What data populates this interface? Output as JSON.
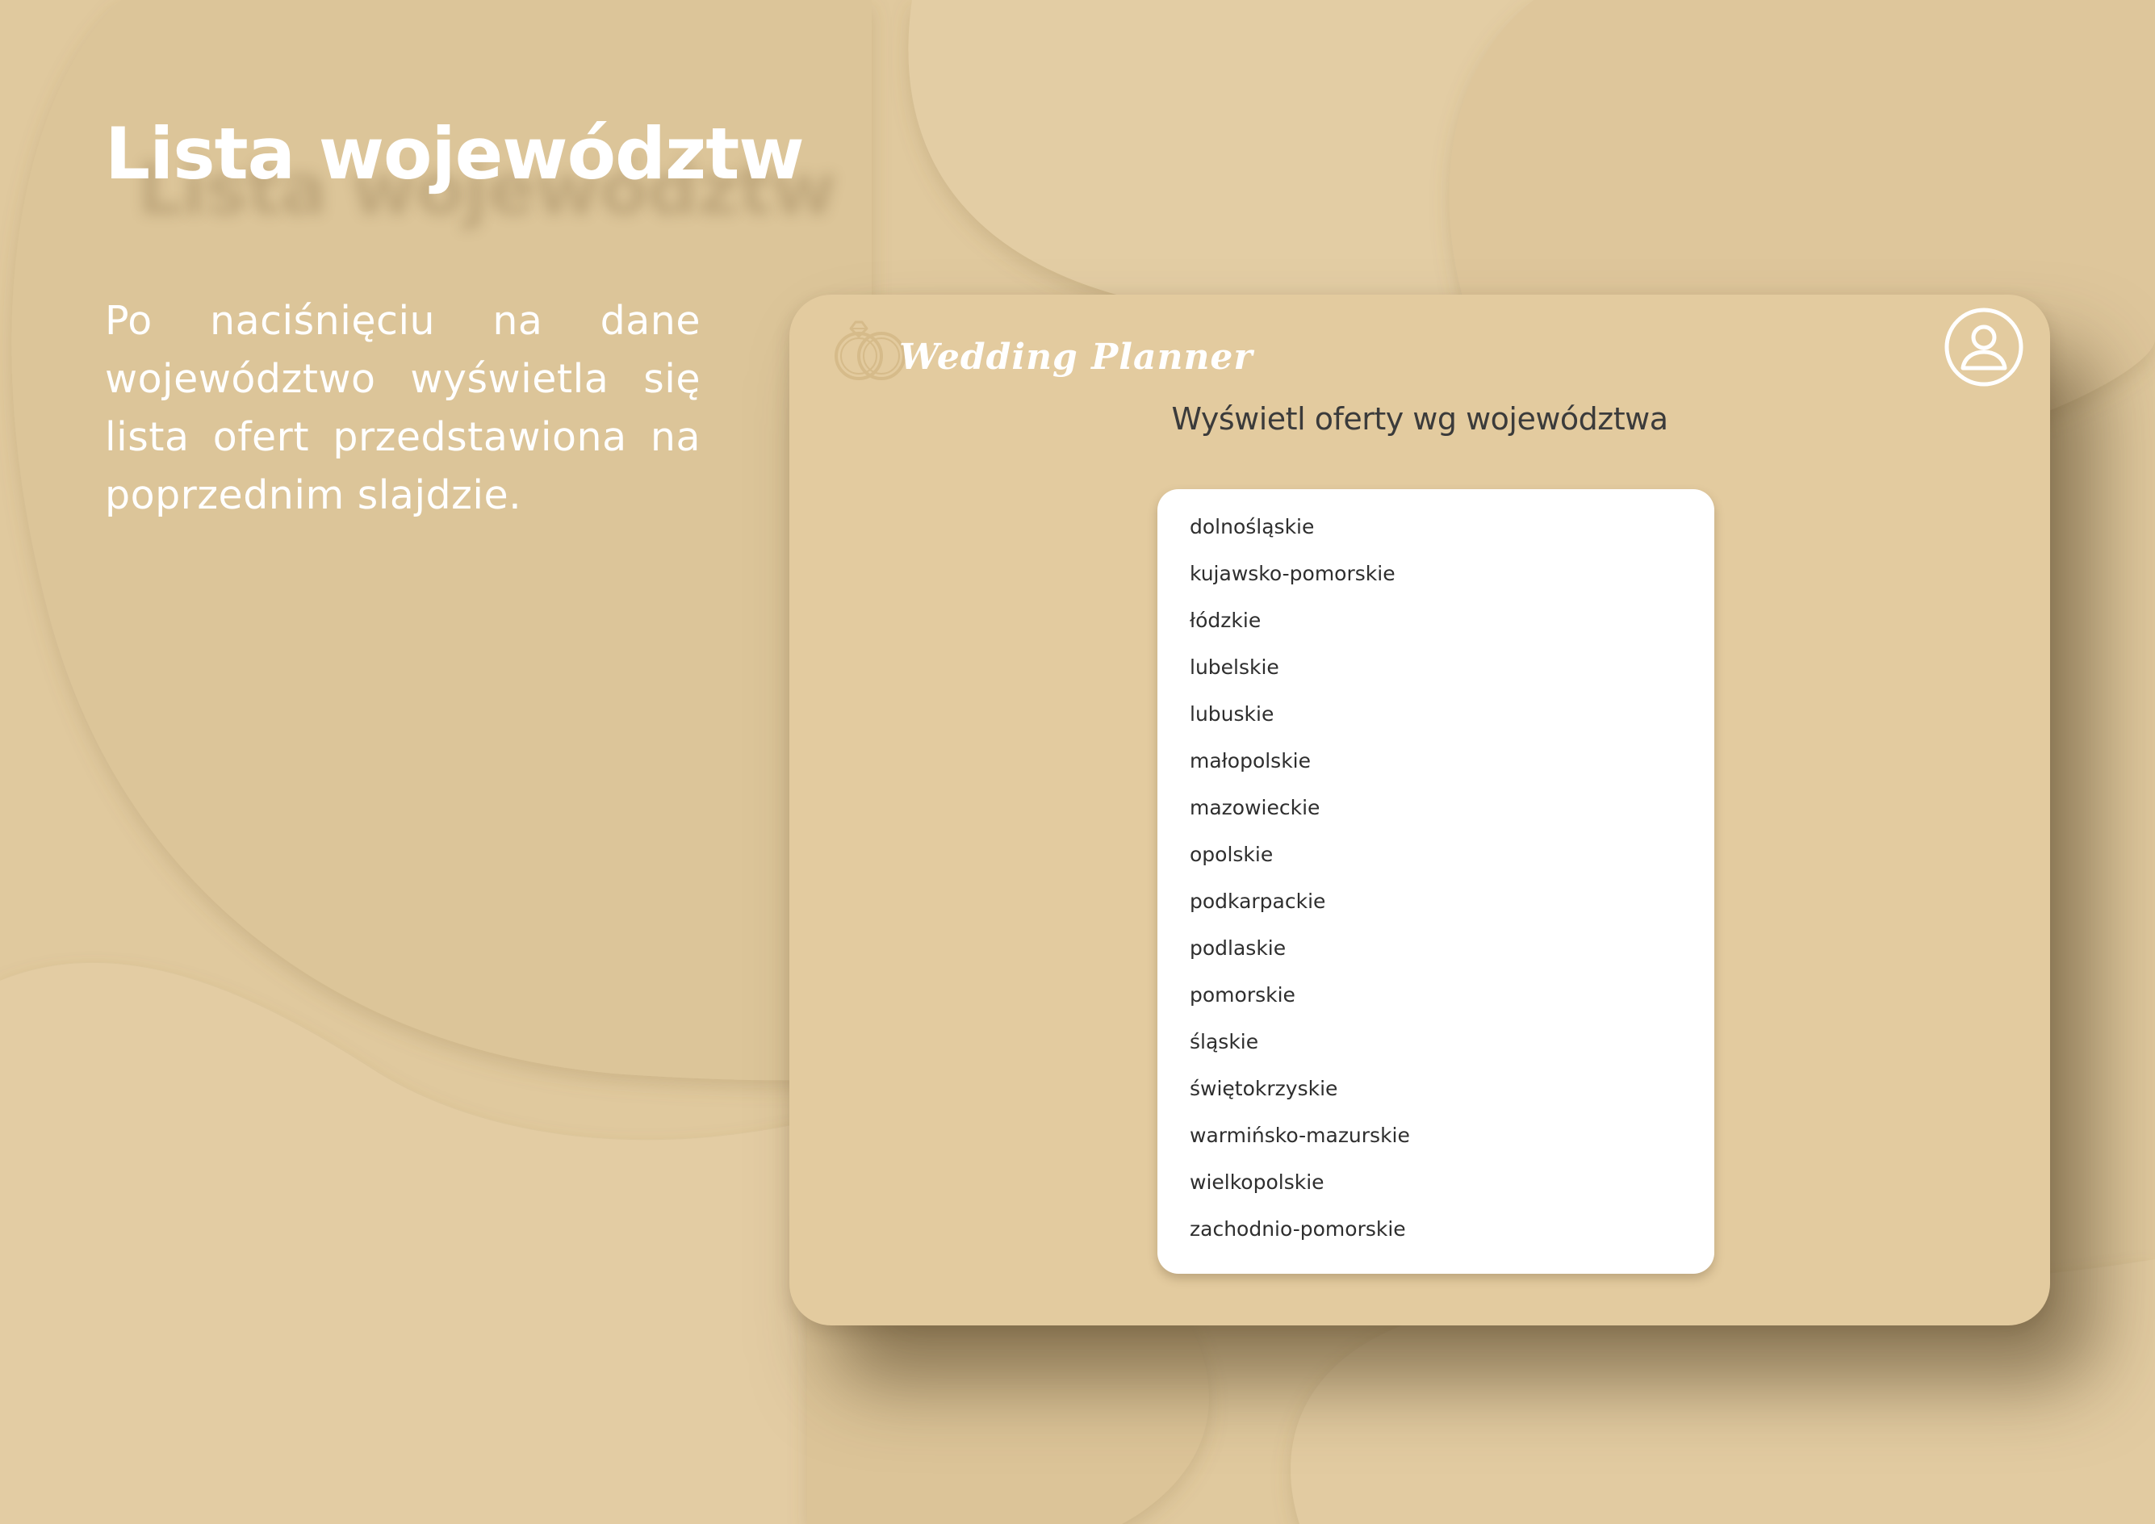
{
  "slide": {
    "title": "Lista województw",
    "description": "Po naciśnięciu na dane województwo wyświetla się lista ofert przedstawiona na poprzednim slajdzie."
  },
  "app": {
    "logo_text": "Wedding Planner",
    "header_title": "Wyświetl oferty wg województwa",
    "regions": [
      "dolnośląskie",
      "kujawsko-pomorskie",
      "łódzkie",
      "lubelskie",
      "lubuskie",
      "małopolskie",
      "mazowieckie",
      "opolskie",
      "podkarpackie",
      "podlaskie",
      "pomorskie",
      "śląskie",
      "świętokrzyskie",
      "warmińsko-mazurskie",
      "wielkopolskie",
      "zachodnio-pomorskie"
    ]
  },
  "icons": {
    "logo": "wedding-rings-icon",
    "profile": "user-profile-icon"
  },
  "colors": {
    "background": "#e0c99e",
    "window": "#e3cb9f",
    "text_light": "#ffffff",
    "text_dark": "#3b3b3b"
  }
}
